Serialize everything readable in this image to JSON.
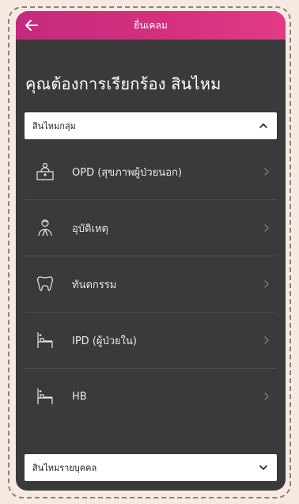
{
  "header": {
    "title": "ยื่นเคลม"
  },
  "page_title": "คุณต้องการเรียกร้อง สินไหม",
  "group_section": {
    "label": "สินไหมกลุ่ม",
    "items": [
      {
        "label": "OPD (สุขภาพผู้ป่วยนอก)",
        "icon": "clinic-desk-icon"
      },
      {
        "label": "อุบัติเหตุ",
        "icon": "injured-person-icon"
      },
      {
        "label": "ทันตกรรม",
        "icon": "tooth-icon"
      },
      {
        "label": "IPD (ผู้ป่วยใน)",
        "icon": "hospital-bed-icon"
      },
      {
        "label": "HB",
        "icon": "hospital-bed-icon"
      }
    ]
  },
  "individual_section": {
    "label": "สินไหมรายบุคคล"
  },
  "colors": {
    "header_start": "#c42a7e",
    "header_end": "#e23a86",
    "panel_bg": "#3a3a3a"
  }
}
